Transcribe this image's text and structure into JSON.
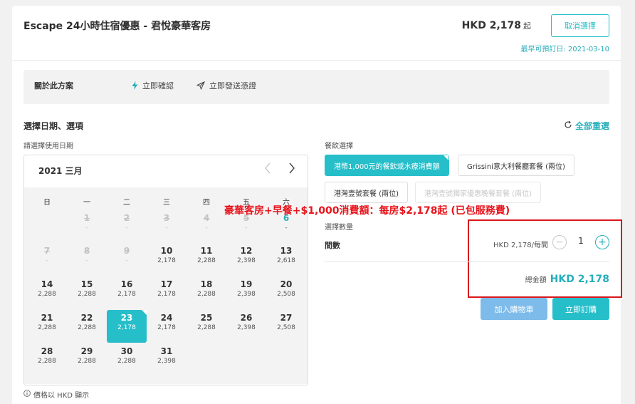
{
  "header": {
    "title": "Escape 24小時住宿優惠 - 君悅豪華客房",
    "price": "HKD 2,178",
    "price_suffix": "起",
    "cancel_label": "取消選擇",
    "earliest": "最早可預訂日: 2021-03-10"
  },
  "info": {
    "label": "關於此方案",
    "item1": "立即確認",
    "item1_icon": "lightning-icon",
    "item2": "立即發送憑證",
    "item2_icon": "send-icon"
  },
  "section": {
    "title": "選擇日期、選項",
    "reset_label": "全部重選",
    "date_label": "請選擇使用日期"
  },
  "calendar": {
    "month": "2021 三月",
    "weekdays": [
      "日",
      "一",
      "二",
      "三",
      "四",
      "五",
      "六"
    ],
    "days": [
      {
        "day": "1",
        "price": "-",
        "col": 1,
        "row": 0,
        "state": "disabled"
      },
      {
        "day": "2",
        "price": "-",
        "col": 2,
        "row": 0,
        "state": "disabled"
      },
      {
        "day": "3",
        "price": "-",
        "col": 3,
        "row": 0,
        "state": "disabled"
      },
      {
        "day": "4",
        "price": "-",
        "col": 4,
        "row": 0,
        "state": "disabled"
      },
      {
        "day": "5",
        "price": "-",
        "col": 5,
        "row": 0,
        "state": "disabled"
      },
      {
        "day": "6",
        "price": "-",
        "col": 6,
        "row": 0,
        "state": "highlight"
      },
      {
        "day": "7",
        "price": "-",
        "col": 0,
        "row": 1,
        "state": "disabled"
      },
      {
        "day": "8",
        "price": "-",
        "col": 1,
        "row": 1,
        "state": "disabled"
      },
      {
        "day": "9",
        "price": "-",
        "col": 2,
        "row": 1,
        "state": "disabled"
      },
      {
        "day": "10",
        "price": "2,178",
        "col": 3,
        "row": 1,
        "state": "normal"
      },
      {
        "day": "11",
        "price": "2,288",
        "col": 4,
        "row": 1,
        "state": "normal"
      },
      {
        "day": "12",
        "price": "2,398",
        "col": 5,
        "row": 1,
        "state": "normal"
      },
      {
        "day": "13",
        "price": "2,618",
        "col": 6,
        "row": 1,
        "state": "normal"
      },
      {
        "day": "14",
        "price": "2,288",
        "col": 0,
        "row": 2,
        "state": "normal"
      },
      {
        "day": "15",
        "price": "2,288",
        "col": 1,
        "row": 2,
        "state": "normal"
      },
      {
        "day": "16",
        "price": "2,178",
        "col": 2,
        "row": 2,
        "state": "normal"
      },
      {
        "day": "17",
        "price": "2,178",
        "col": 3,
        "row": 2,
        "state": "normal"
      },
      {
        "day": "18",
        "price": "2,288",
        "col": 4,
        "row": 2,
        "state": "normal"
      },
      {
        "day": "19",
        "price": "2,398",
        "col": 5,
        "row": 2,
        "state": "normal"
      },
      {
        "day": "20",
        "price": "2,508",
        "col": 6,
        "row": 2,
        "state": "normal"
      },
      {
        "day": "21",
        "price": "2,288",
        "col": 0,
        "row": 3,
        "state": "normal"
      },
      {
        "day": "22",
        "price": "2,288",
        "col": 1,
        "row": 3,
        "state": "normal"
      },
      {
        "day": "23",
        "price": "2,178",
        "col": 2,
        "row": 3,
        "state": "selected"
      },
      {
        "day": "24",
        "price": "2,178",
        "col": 3,
        "row": 3,
        "state": "normal"
      },
      {
        "day": "25",
        "price": "2,288",
        "col": 4,
        "row": 3,
        "state": "normal"
      },
      {
        "day": "26",
        "price": "2,398",
        "col": 5,
        "row": 3,
        "state": "normal"
      },
      {
        "day": "27",
        "price": "2,508",
        "col": 6,
        "row": 3,
        "state": "normal"
      },
      {
        "day": "28",
        "price": "2,288",
        "col": 0,
        "row": 4,
        "state": "normal"
      },
      {
        "day": "29",
        "price": "2,288",
        "col": 1,
        "row": 4,
        "state": "normal"
      },
      {
        "day": "30",
        "price": "2,288",
        "col": 2,
        "row": 4,
        "state": "normal"
      },
      {
        "day": "31",
        "price": "2,398",
        "col": 3,
        "row": 4,
        "state": "normal"
      }
    ],
    "note": "價格以 HKD 顯示"
  },
  "dining": {
    "label": "餐飲選擇",
    "options": [
      {
        "label": "港幣1,000元的餐飲或水療消費額",
        "state": "active"
      },
      {
        "label": "Grissini意大利餐廳套餐 (兩位)",
        "state": "normal"
      },
      {
        "label": "港灣壹號套餐 (兩位)",
        "state": "normal"
      },
      {
        "label": "港灣壹號獨家優惠晚餐套餐 (兩位)",
        "state": "disabled"
      }
    ]
  },
  "promo": "豪華客房+早餐+$1,000消費額：每房$2,178起 (已包服務費)",
  "quantity": {
    "label": "選擇數量",
    "room_label": "間數",
    "unit_price": "HKD 2,178/每間",
    "value": "1",
    "minus": "−",
    "plus": "+"
  },
  "total": {
    "label": "總金額",
    "value": "HKD 2,178"
  },
  "actions": {
    "cart": "加入購物車",
    "book": "立即訂購"
  },
  "colors": {
    "accent": "#26bec9",
    "accent_text": "#26aebb",
    "cart_button": "#7dbbea",
    "promo_red": "#e8141c"
  }
}
